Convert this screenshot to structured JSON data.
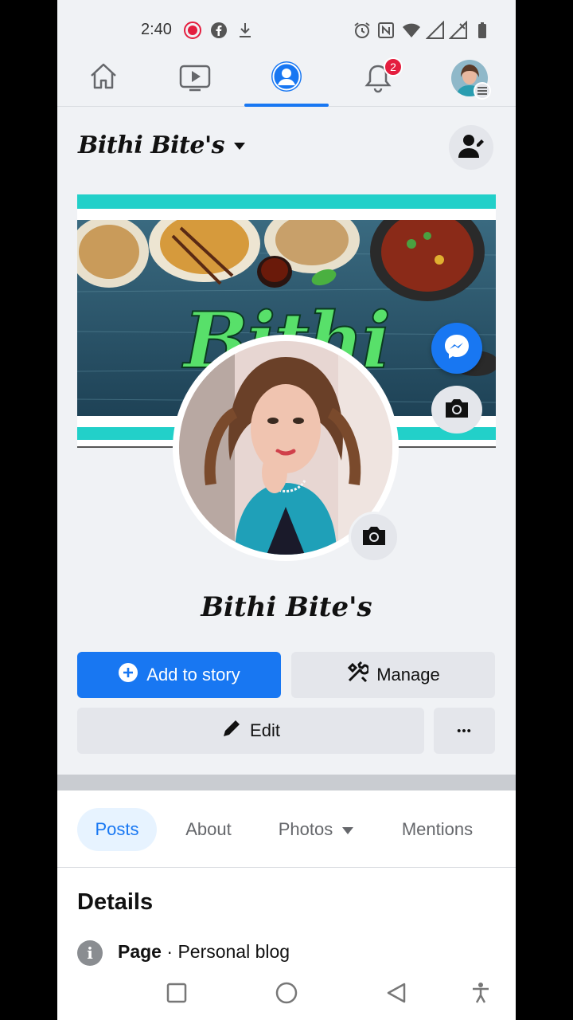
{
  "status_bar": {
    "time": "2:40",
    "icons": [
      "recording-icon",
      "facebook-icon",
      "download-icon",
      "alarm-icon",
      "nfc-icon",
      "wifi-icon",
      "signal-icon",
      "no-signal-icon",
      "battery-icon"
    ]
  },
  "top_nav": {
    "items": [
      {
        "name": "home-icon"
      },
      {
        "name": "video-icon"
      },
      {
        "name": "profile-icon",
        "active": true
      },
      {
        "name": "bell-icon",
        "badge": "2"
      },
      {
        "name": "avatar-menu"
      }
    ]
  },
  "header": {
    "page_name": "Bithi Bite's"
  },
  "cover": {
    "title": "Bithi Bites"
  },
  "profile": {
    "name": "Bithi Bite's"
  },
  "actions": {
    "add_story": "Add to story",
    "manage": "Manage",
    "edit": "Edit",
    "more": "•••"
  },
  "tabs": {
    "posts": "Posts",
    "about": "About",
    "photos": "Photos",
    "mentions": "Mentions"
  },
  "details": {
    "title": "Details",
    "label": "Page",
    "separator": " · ",
    "category": "Personal blog"
  },
  "colors": {
    "accent": "#1877f2",
    "badge": "#e41e3f",
    "cover_band": "#22d0c9"
  }
}
